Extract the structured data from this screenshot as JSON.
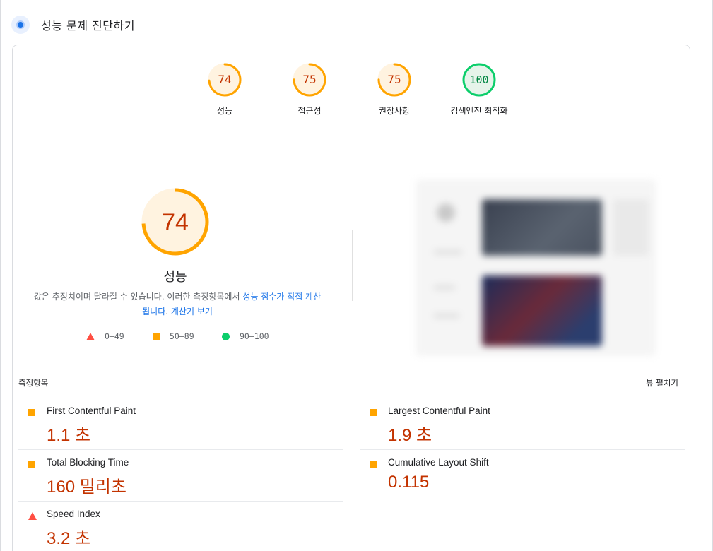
{
  "header": {
    "title": "성능 문제 진단하기",
    "icon": "diagnose-icon"
  },
  "colors": {
    "average": "#ffa400",
    "fail": "#ff4e42",
    "pass": "#0cce6b",
    "value_text": "#c33300",
    "link": "#1a73e8"
  },
  "gauges": [
    {
      "score": "74",
      "label": "성능",
      "status": "average"
    },
    {
      "score": "75",
      "label": "접근성",
      "status": "average"
    },
    {
      "score": "75",
      "label": "권장사항",
      "status": "average"
    },
    {
      "score": "100",
      "label": "검색엔진 최적화",
      "status": "pass"
    }
  ],
  "main_gauge": {
    "score": "74",
    "title": "성능"
  },
  "note": {
    "text1": "값은 추정치이며 달라질 수 있습니다. 이러한 측정항목에서 ",
    "link1": "성능 점수가 직접 계산됩니다",
    "text2": ". ",
    "link2": "계산기 보기"
  },
  "legend": [
    {
      "shape": "triangle",
      "range": "0–49"
    },
    {
      "shape": "square",
      "range": "50–89"
    },
    {
      "shape": "circle",
      "range": "90–100"
    }
  ],
  "metrics_section": {
    "title": "측정항목",
    "expand_label": "뷰 펼치기"
  },
  "metrics": [
    {
      "name": "First Contentful Paint",
      "value": "1.1 초",
      "status": "average"
    },
    {
      "name": "Largest Contentful Paint",
      "value": "1.9 초",
      "status": "average"
    },
    {
      "name": "Total Blocking Time",
      "value": "160 밀리초",
      "status": "average"
    },
    {
      "name": "Cumulative Layout Shift",
      "value": "0.115",
      "status": "average"
    },
    {
      "name": "Speed Index",
      "value": "3.2 초",
      "status": "fail"
    }
  ]
}
